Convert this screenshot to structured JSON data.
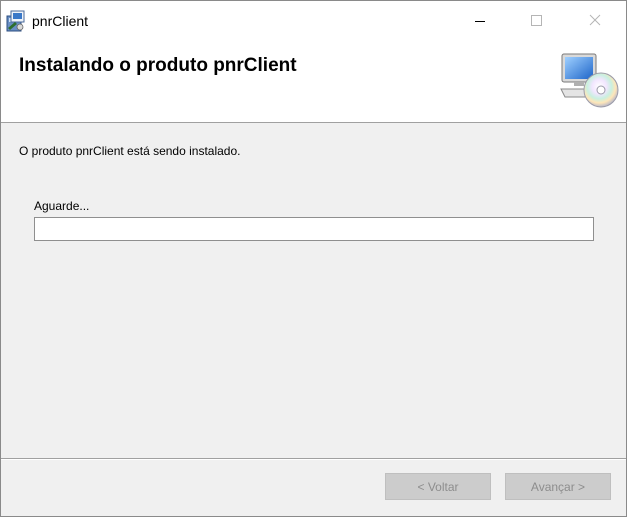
{
  "window": {
    "title": "pnrClient",
    "app_icon": "installer-package-icon",
    "controls": {
      "minimize_icon": "minimize-icon",
      "maximize_icon": "maximize-icon",
      "close_icon": "close-icon"
    }
  },
  "banner": {
    "title": "Instalando o produto pnrClient",
    "icon": "computer-cd-icon"
  },
  "main": {
    "status_text": "O produto pnrClient está sendo instalado.",
    "progress_label": "Aguarde...",
    "progress_fraction": 0
  },
  "footer": {
    "back_label": "< Voltar",
    "next_label": "Avançar >",
    "back_enabled": false,
    "next_enabled": false
  },
  "colors": {
    "window_background": "#f0f0f0",
    "banner_background": "#ffffff",
    "progress_fill": "#06b025",
    "disabled_button_text": "#8d8d8d"
  }
}
